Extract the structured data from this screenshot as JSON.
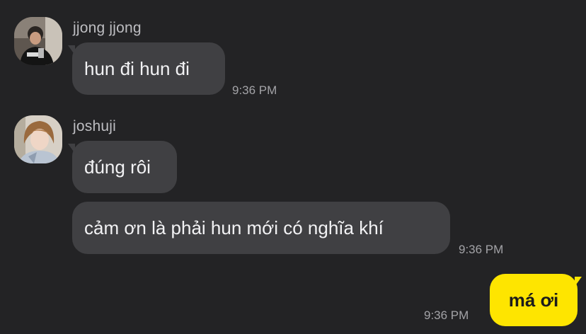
{
  "colors": {
    "background": "#232325",
    "incoming_bubble": "#404043",
    "outgoing_bubble": "#fee500",
    "name_text": "#bdbdc1",
    "time_text": "#a3a3a7"
  },
  "messages": [
    {
      "sender": "jjong jjong",
      "avatar": "profile-photo",
      "bubbles": [
        "hun đi hun đi"
      ],
      "time": "9:36 PM"
    },
    {
      "sender": "joshuji",
      "avatar": "profile-photo",
      "bubbles": [
        "đúng rôi",
        "cảm ơn là phải hun mới có nghĩa khí"
      ],
      "time": "9:36 PM"
    },
    {
      "sender": "me",
      "bubbles": [
        "má ơi"
      ],
      "time": "9:36 PM"
    }
  ]
}
